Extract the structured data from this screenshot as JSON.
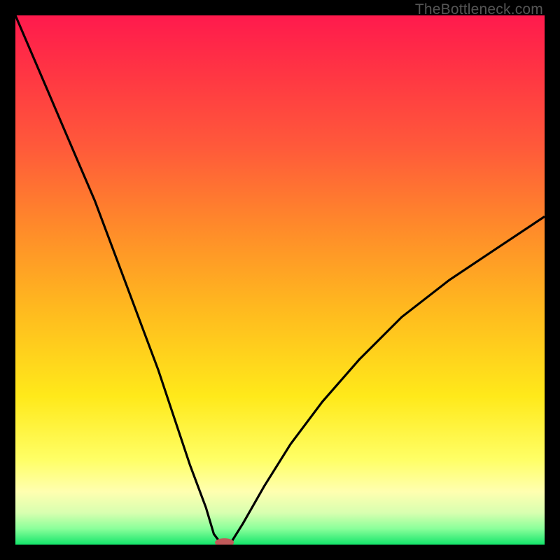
{
  "attribution": "TheBottleneck.com",
  "colors": {
    "curve_stroke": "#000000",
    "marker_fill": "#c15a5a",
    "gradient_top": "#ff1a4d",
    "gradient_bottom": "#14e56b"
  },
  "chart_data": {
    "type": "line",
    "title": "",
    "xlabel": "",
    "ylabel": "",
    "xlim": [
      0,
      100
    ],
    "ylim": [
      0,
      100
    ],
    "note": "V-shaped bottleneck curve; minimum around x≈39 where y≈0; left branch starts at (0,100); right branch ends near (100,62). Values estimated from pixels.",
    "series": [
      {
        "name": "curve",
        "x": [
          0,
          3,
          6,
          9,
          12,
          15,
          18,
          21,
          24,
          27,
          30,
          33,
          36,
          37.5,
          39,
          40.5,
          43,
          47,
          52,
          58,
          65,
          73,
          82,
          91,
          100
        ],
        "y": [
          100,
          93,
          86,
          79,
          72,
          65,
          57,
          49,
          41,
          33,
          24,
          15,
          7,
          2,
          0,
          0,
          4,
          11,
          19,
          27,
          35,
          43,
          50,
          56,
          62
        ]
      }
    ],
    "marker": {
      "x": 39.5,
      "y": 0.4,
      "rx": 1.8,
      "ry": 0.8
    }
  }
}
